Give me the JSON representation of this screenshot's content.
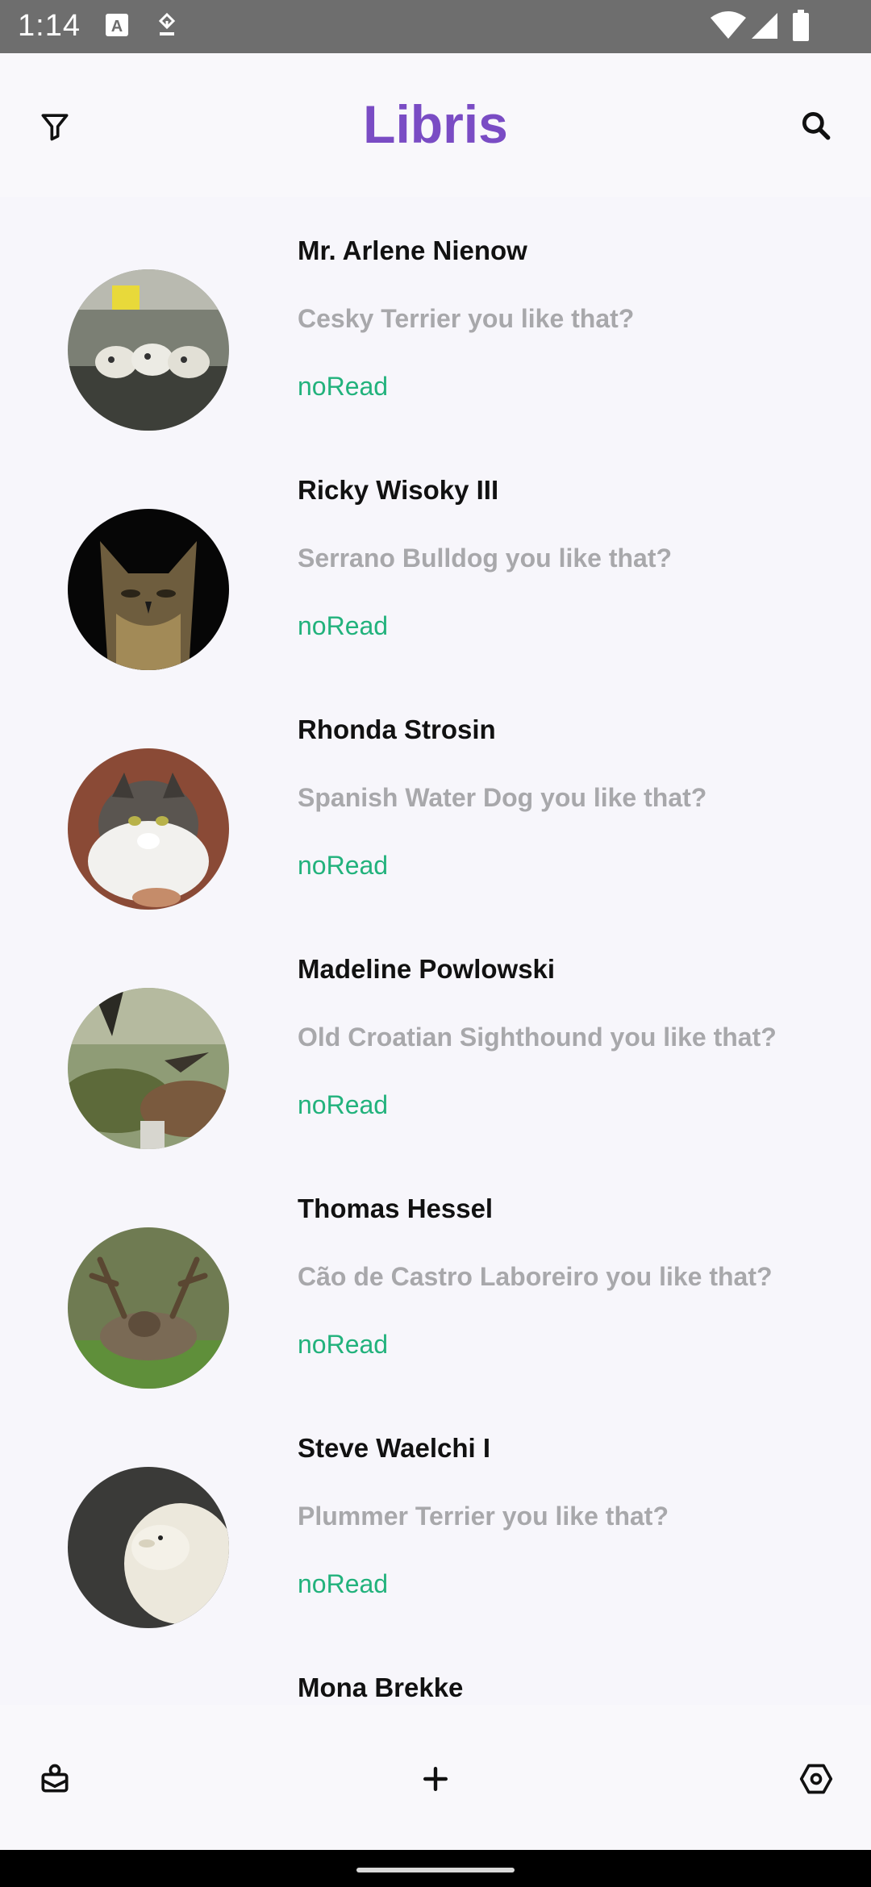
{
  "status_bar": {
    "time": "1:14",
    "icons": [
      "text-a-icon",
      "download-badge-icon",
      "wifi-icon",
      "cell-signal-icon",
      "battery-icon"
    ]
  },
  "app_bar": {
    "title": "Libris",
    "left_icon": "filter-icon",
    "right_icon": "search-icon"
  },
  "colors": {
    "accent": "#7a4cc4",
    "status_green": "#22b27c",
    "message_grey": "#a8a8ab",
    "background": "#f7f6fb"
  },
  "list": {
    "items": [
      {
        "name": "Mr. Arlene Nienow",
        "message": "Cesky Terrier you like that?",
        "status": "noRead",
        "avatar": "mice-skulls-photo"
      },
      {
        "name": "Ricky Wisoky III",
        "message": "Serrano Bulldog you like that?",
        "status": "noRead",
        "avatar": "owl-photo"
      },
      {
        "name": "Rhonda Strosin",
        "message": "Spanish Water Dog you like that?",
        "status": "noRead",
        "avatar": "cat-photo"
      },
      {
        "name": "Madeline Powlowski",
        "message": "Old Croatian Sighthound you like that?",
        "status": "noRead",
        "avatar": "birds-photo"
      },
      {
        "name": "Thomas Hessel",
        "message": "Cão de Castro Laboreiro you like that?",
        "status": "noRead",
        "avatar": "deer-photo"
      },
      {
        "name": "Steve Waelchi I",
        "message": "Plummer Terrier you like that?",
        "status": "noRead",
        "avatar": "sheep-photo"
      },
      {
        "name": "Mona Brekke",
        "message": "",
        "status": "",
        "avatar": "partial-photo"
      }
    ]
  },
  "bottom_bar": {
    "icons": [
      "inbox-person-icon",
      "plus-icon",
      "settings-hexagon-icon"
    ]
  }
}
